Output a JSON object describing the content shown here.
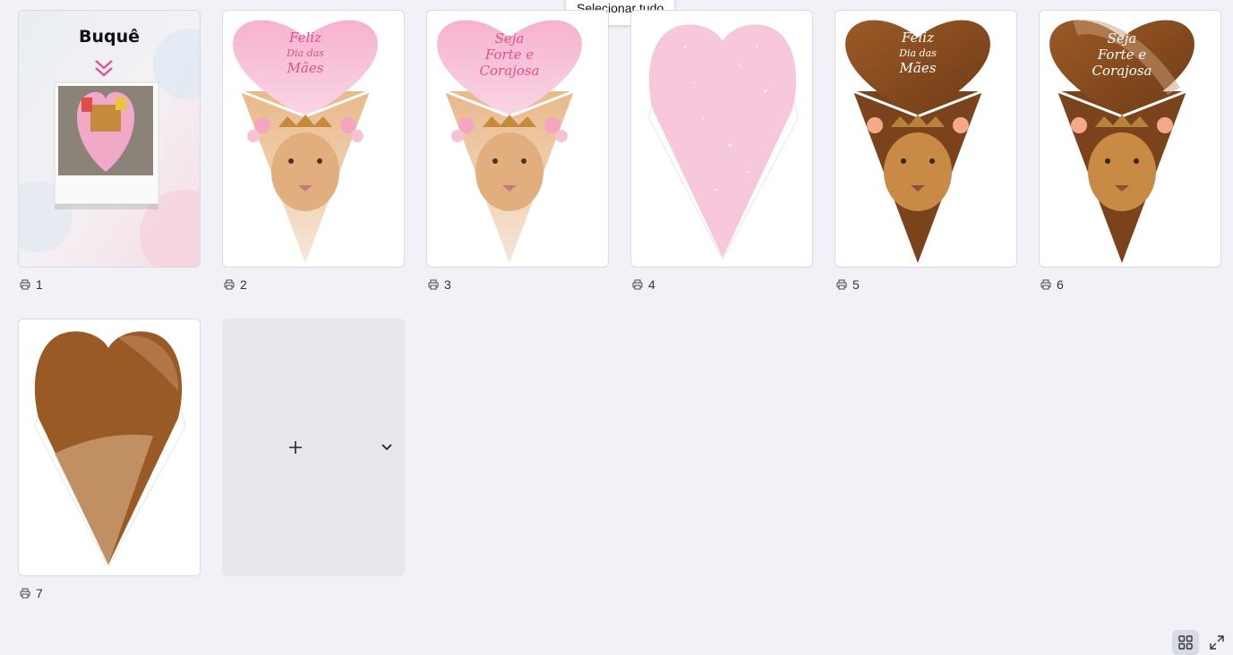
{
  "tooltip": {
    "label": "Selecionar tudo"
  },
  "pages": [
    {
      "number": "1",
      "thumb_title": "Buquê"
    },
    {
      "number": "2",
      "thumb_text": [
        "Feliz",
        "Dia das",
        "Mães"
      ]
    },
    {
      "number": "3",
      "thumb_text": [
        "Seja",
        "Forte e",
        "Corajosa"
      ]
    },
    {
      "number": "4"
    },
    {
      "number": "5",
      "thumb_text": [
        "Feliz",
        "Dia das",
        "Mães"
      ]
    },
    {
      "number": "6",
      "thumb_text": [
        "Seja",
        "Forte e",
        "Corajosa"
      ]
    },
    {
      "number": "7"
    }
  ],
  "add_page": {
    "icon": "plus-icon",
    "menu_icon": "chevron-down-icon"
  },
  "view_controls": {
    "grid_icon": "grid-view-icon",
    "expand_icon": "expand-icon"
  },
  "colors": {
    "pink": "#ee5d9c",
    "pink_light": "#f7c3d9",
    "brown": "#8a4d1f",
    "page_bg": "#f1f2f7"
  }
}
